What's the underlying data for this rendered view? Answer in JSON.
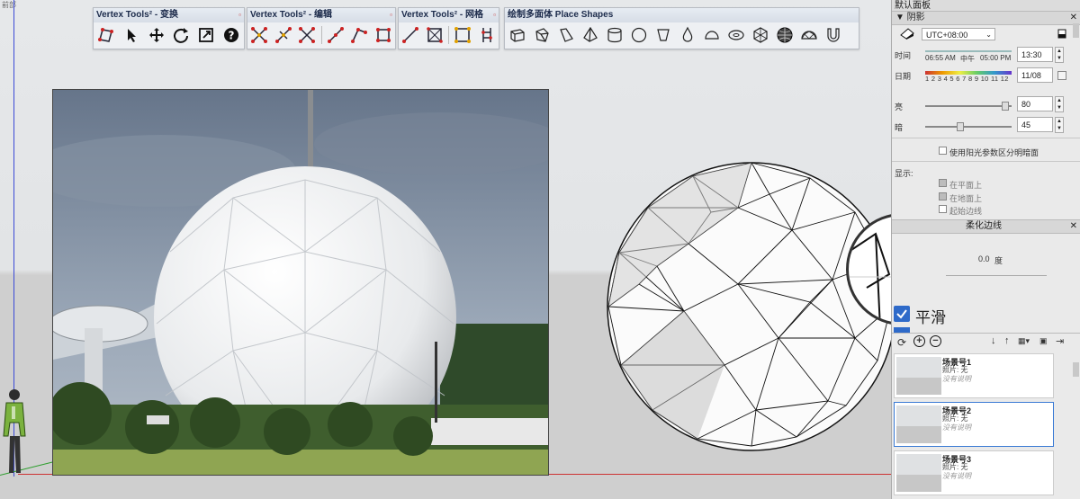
{
  "viewport": {
    "corner_label": "前部"
  },
  "toolbars": [
    {
      "title": "Vertex Tools² - 变换",
      "icons": [
        "lasso-select-icon",
        "arrow-select-icon",
        "move-icon",
        "rotate-icon",
        "scale-icon",
        "help-icon"
      ]
    },
    {
      "title": "Vertex Tools² - 编辑",
      "icons": [
        "merge-vertices-icon",
        "weld-icon",
        "delete-vertices-icon",
        "split-edge-icon",
        "insert-vertex-icon",
        "extrude-icon"
      ]
    },
    {
      "title": "Vertex Tools² - 网格",
      "icons": [
        "connect-icon",
        "triangulate-icon",
        "quad-grid-icon",
        "mesh-icon"
      ]
    },
    {
      "title": "绘制多面体 Place Shapes",
      "icons": [
        "box-shape-icon",
        "prism-shape-icon",
        "wedge-shape-icon",
        "pyramid-shape-icon",
        "cylinder-shape-icon",
        "circle-shape-icon",
        "cone-shape-icon",
        "teardrop-shape-icon",
        "dome-shape-icon",
        "torus-shape-icon",
        "geodesic-shape-icon",
        "sphere-shape-icon",
        "geodome-shape-icon",
        "tube-shape-icon"
      ]
    }
  ],
  "panel": {
    "title": "默认面板",
    "shadow_section": "▼ 阴影",
    "timezone": "UTC+08:00",
    "time_label": "时间",
    "time_start": "06:55 AM",
    "time_mid": "中午",
    "time_end": "05:00 PM",
    "time_value": "13:30",
    "date_label": "日期",
    "date_ticks": "1 2 3 4 5 6 7 8 9 10 11 12",
    "date_value": "11/08",
    "light_label": "亮",
    "light_value": "80",
    "light_level": 0.92,
    "dark_label": "暗",
    "dark_value": "45",
    "dark_level": 0.4,
    "use_sun_label": "使用阳光参数区分明暗面",
    "display_label": "显示:",
    "on_faces": "在平面上",
    "on_ground": "在地面上",
    "from_edges": "起始边线",
    "soft_section": "柔化边线",
    "angle_value": "0.0",
    "angle_unit": "度",
    "smooth_label": "平滑",
    "scenes": [
      {
        "name": "场景号1",
        "photo": "照片: 无",
        "desc": "没有说明"
      },
      {
        "name": "场景号2",
        "photo": "照片: 无",
        "desc": "没有说明"
      },
      {
        "name": "场景号3",
        "photo": "照片: 无",
        "desc": "没有说明"
      }
    ]
  }
}
